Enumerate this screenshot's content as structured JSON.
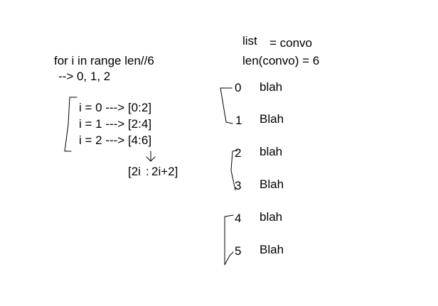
{
  "left": {
    "loop_header": "for i in range len//6",
    "loop_values": "--> 0, 1, 2",
    "mappings": [
      "i = 0 ---> [0:2]",
      "i = 1 ---> [2:4]",
      "i = 2 ---> [4:6]"
    ],
    "formula_left": "[2i",
    "formula_colon": ":",
    "formula_right": "2i+2]"
  },
  "right": {
    "list_label": "list",
    "list_assign": "= convo",
    "len_expr": "len(convo) = 6",
    "items": [
      {
        "index": "0",
        "text": "blah"
      },
      {
        "index": "1",
        "text": "Blah"
      },
      {
        "index": "2",
        "text": "blah"
      },
      {
        "index": "3",
        "text": "Blah"
      },
      {
        "index": "4",
        "text": "blah"
      },
      {
        "index": "5",
        "text": "Blah"
      }
    ]
  }
}
